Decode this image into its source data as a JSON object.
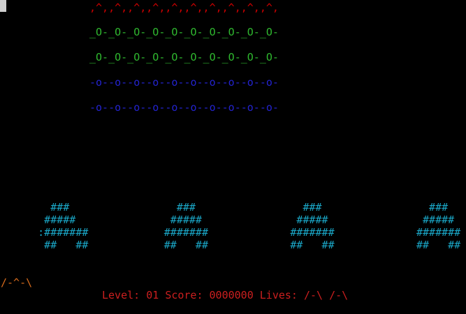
{
  "invaders": {
    "row1": ",^,,^,,^,,^,,^,,^,,^,,^,,^,,^,",
    "row2": "_O-_O-_O-_O-_O-_O-_O-_O-_O-_O-",
    "row3": "_O-_O-_O-_O-_O-_O-_O-_O-_O-_O-",
    "row4": "-o--o--o--o--o--o--o--o--o--o-",
    "row5": "-o--o--o--o--o--o--o--o--o--o-"
  },
  "bunkers": {
    "lines": [
      "       ###                 ###                 ###                 ###",
      "      #####               #####               #####               #####",
      "     :#######            #######             #######             #######",
      "      ##   ##            ##   ##             ##   ##             ##   ##"
    ]
  },
  "player": {
    "ship": "/-^-\\"
  },
  "status_bar": {
    "level_label": "Level:",
    "level_value": "01",
    "score_label": "Score:",
    "score_value": "0000000",
    "lives_label": "Lives:",
    "lives_icons": "/-\\ /-\\"
  },
  "colors": {
    "background": "#000000",
    "invader_row_1": "#cc0000",
    "invader_rows_2_3": "#2fb82f",
    "invader_rows_4_5": "#2323cf",
    "bunkers": "#1aa7c7",
    "player": "#d76b1c",
    "status": "#cc1f1f",
    "cursor": "#cfcfcf"
  }
}
